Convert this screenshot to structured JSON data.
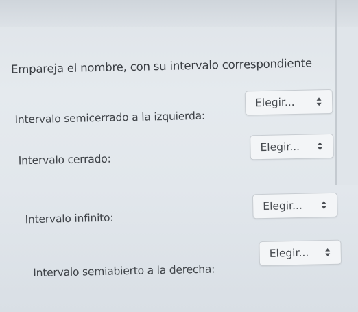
{
  "question": {
    "title": "Empareja el nombre, con su intervalo correspondiente"
  },
  "rows": [
    {
      "label": "Intervalo semicerrado a la izquierda:",
      "select_value": "Elegir..."
    },
    {
      "label": "Intervalo cerrado:",
      "select_value": "Elegir..."
    },
    {
      "label": "Intervalo infinito:",
      "select_value": "Elegir..."
    },
    {
      "label": "Intervalo semiabierto a la derecha:",
      "select_value": "Elegir..."
    }
  ],
  "icons": {
    "select_arrow": "up-down-arrows-icon"
  }
}
